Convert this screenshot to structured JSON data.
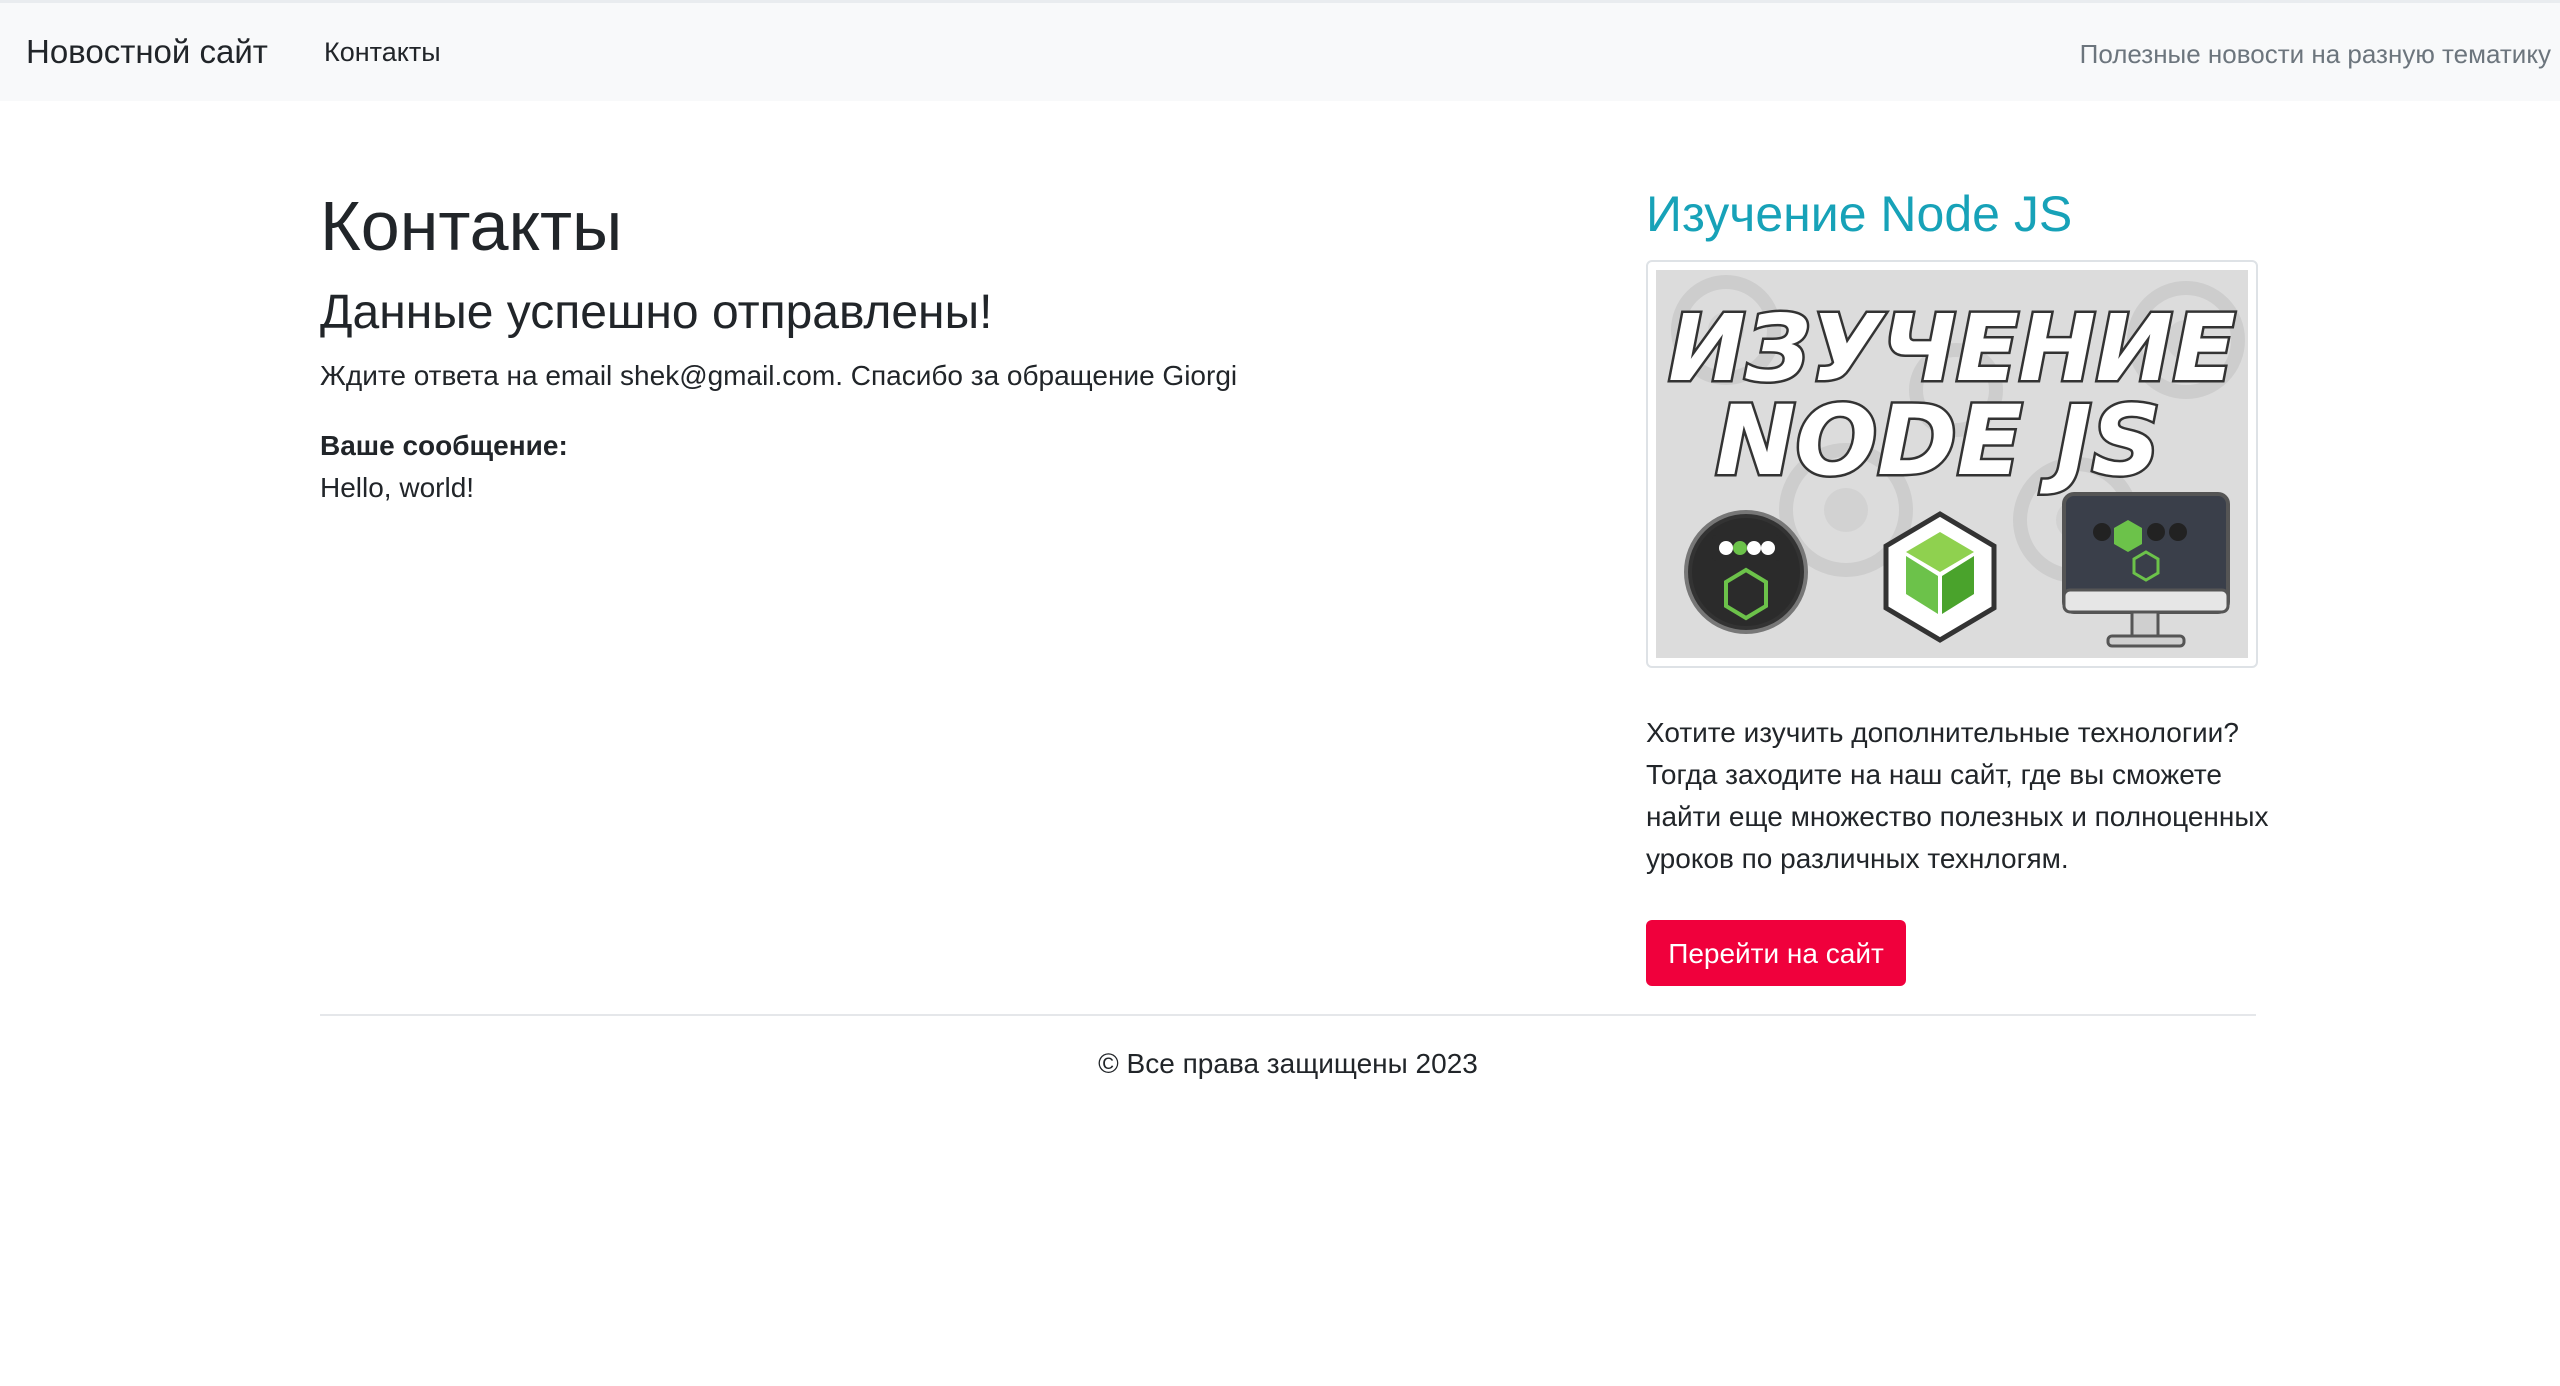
{
  "navbar": {
    "brand": "Новостной сайт",
    "link_contacts": "Контакты",
    "tagline": "Полезные новости на разную тематику"
  },
  "main": {
    "title": "Контакты",
    "success_heading": "Данные успешно отправлены!",
    "notice": "Ждите ответа на email shek@gmail.com. Спасибо за обращение Giorgi",
    "message_label": "Ваше сообщение:",
    "message_body": "Hello, world!"
  },
  "aside": {
    "title": "Изучение Node JS",
    "image_text_line1": "ИЗУЧЕНИЕ",
    "image_text_line2": "NODE JS",
    "description": "Хотите изучить дополнительные технологии? Тогда заходите на наш сайт, где вы сможете найти еще множество полезных и полноценных уроков по различных технлогям.",
    "button_label": "Перейти на сайт"
  },
  "footer": {
    "copyright": "© Все права защищены 2023"
  },
  "colors": {
    "accent_title": "#17a2b8",
    "button_bg": "#f0003c",
    "navbar_bg": "#f8f9fa"
  }
}
